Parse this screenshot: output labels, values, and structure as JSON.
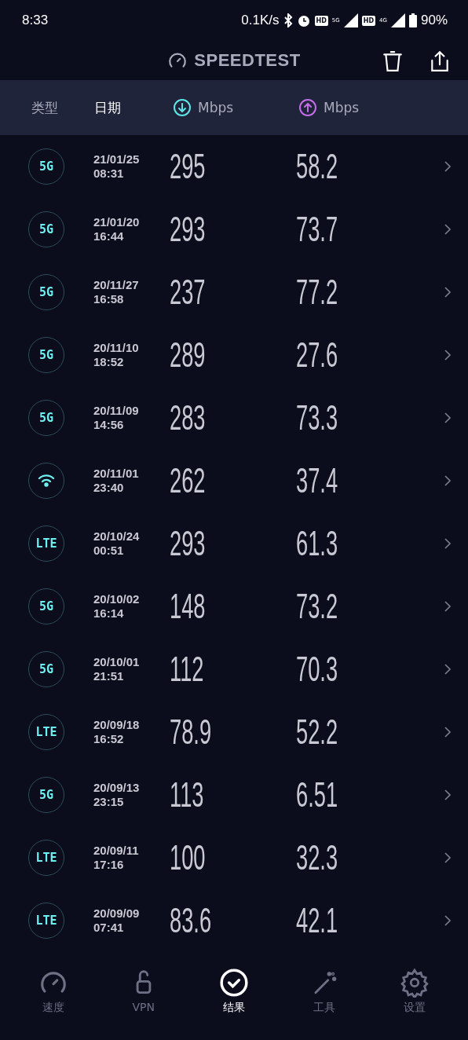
{
  "status_bar": {
    "time": "8:33",
    "net_speed": "0.1K/s",
    "sims": [
      {
        "hd": "HD",
        "network": "5G"
      },
      {
        "hd": "HD",
        "network": "4G"
      }
    ],
    "battery": "90%"
  },
  "header": {
    "title": "SPEEDTEST"
  },
  "columns": [
    {
      "kind": "text",
      "label": "类型",
      "selected": false
    },
    {
      "kind": "text",
      "label": "日期",
      "selected": true
    },
    {
      "kind": "download",
      "label": "Mbps",
      "selected": false
    },
    {
      "kind": "upload",
      "label": "Mbps",
      "selected": false
    }
  ],
  "rows": [
    {
      "kind": "cell",
      "type": "5G",
      "date": "21/01/25",
      "time": "08:31",
      "download": "295",
      "upload": "58.2"
    },
    {
      "kind": "cell",
      "type": "5G",
      "date": "21/01/20",
      "time": "16:44",
      "download": "293",
      "upload": "73.7"
    },
    {
      "kind": "cell",
      "type": "5G",
      "date": "20/11/27",
      "time": "16:58",
      "download": "237",
      "upload": "77.2"
    },
    {
      "kind": "cell",
      "type": "5G",
      "date": "20/11/10",
      "time": "18:52",
      "download": "289",
      "upload": "27.6"
    },
    {
      "kind": "cell",
      "type": "5G",
      "date": "20/11/09",
      "time": "14:56",
      "download": "283",
      "upload": "73.3"
    },
    {
      "kind": "wifi",
      "date": "20/11/01",
      "time": "23:40",
      "download": "262",
      "upload": "37.4"
    },
    {
      "kind": "cell",
      "type": "LTE",
      "date": "20/10/24",
      "time": "00:51",
      "download": "293",
      "upload": "61.3"
    },
    {
      "kind": "cell",
      "type": "5G",
      "date": "20/10/02",
      "time": "16:14",
      "download": "148",
      "upload": "73.2"
    },
    {
      "kind": "cell",
      "type": "5G",
      "date": "20/10/01",
      "time": "21:51",
      "download": "112",
      "upload": "70.3"
    },
    {
      "kind": "cell",
      "type": "LTE",
      "date": "20/09/18",
      "time": "16:52",
      "download": "78.9",
      "upload": "52.2"
    },
    {
      "kind": "cell",
      "type": "5G",
      "date": "20/09/13",
      "time": "23:15",
      "download": "113",
      "upload": "6.51"
    },
    {
      "kind": "cell",
      "type": "LTE",
      "date": "20/09/11",
      "time": "17:16",
      "download": "100",
      "upload": "32.3"
    },
    {
      "kind": "cell",
      "type": "LTE",
      "date": "20/09/09",
      "time": "07:41",
      "download": "83.6",
      "upload": "42.1"
    }
  ],
  "nav": [
    {
      "kind": "speed",
      "label": "速度",
      "selected": false
    },
    {
      "kind": "vpn",
      "label": "VPN",
      "selected": false
    },
    {
      "kind": "results",
      "label": "结果",
      "selected": true
    },
    {
      "kind": "tools",
      "label": "工具",
      "selected": false
    },
    {
      "kind": "settings",
      "label": "设置",
      "selected": false
    }
  ]
}
